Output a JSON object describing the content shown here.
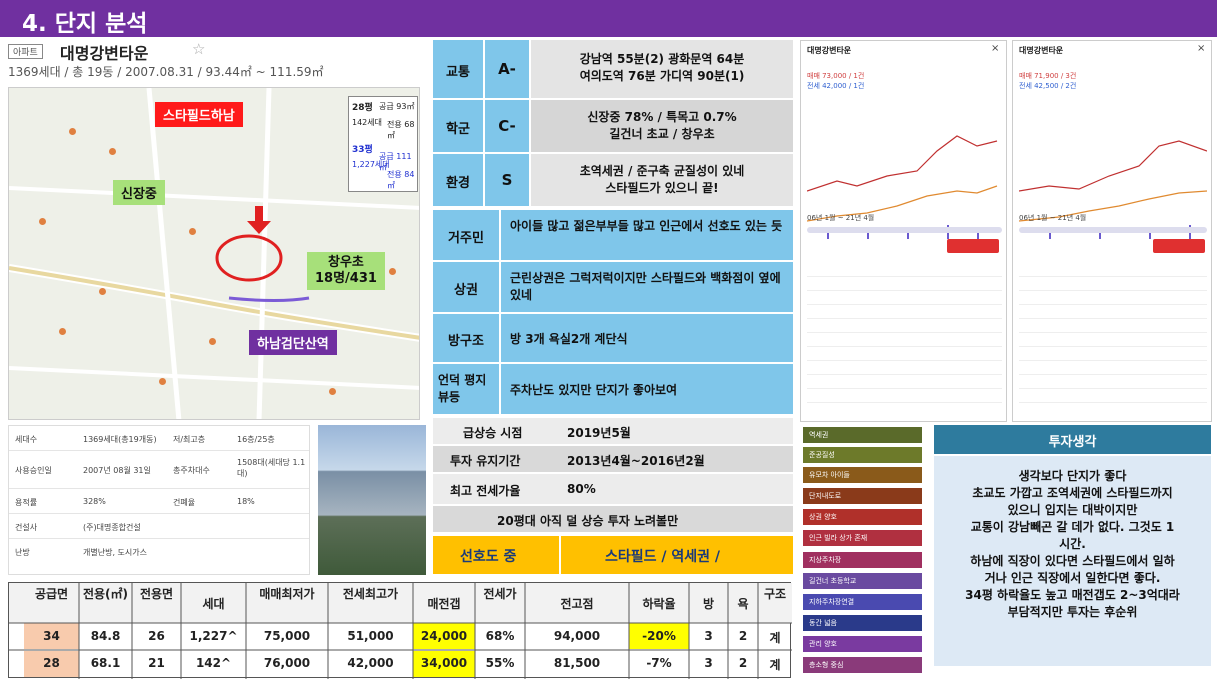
{
  "header": {
    "title": "4. 단지 분석"
  },
  "apt": {
    "tag": "아파트",
    "name": "대명강변타운",
    "star": "☆",
    "sub": "1369세대 / 총 19동 / 2007.08.31 / 93.44㎡ ~ 111.59㎡"
  },
  "map": {
    "labels": [
      "스타필드하남",
      "신장중",
      "창우초\n18명/431",
      "하남검단산역"
    ],
    "legend": [
      "28평",
      "공급 93㎡",
      "142세대",
      "전용 68㎡",
      "33평",
      "공급 111㎡",
      "1,227세대",
      "전용 84㎡"
    ]
  },
  "info": {
    "rows": [
      [
        "세대수",
        "1369세대(총19개동)",
        "저/최고층",
        "16층/25층"
      ],
      [
        "사용승인일",
        "2007년 08월 31일",
        "총주차대수",
        "1508대(세대당 1.1대)"
      ],
      [
        "용적률",
        "328%",
        "건폐율",
        "18%"
      ],
      [
        "건설사",
        "(주)대명종합건설",
        "",
        ""
      ],
      [
        "난방",
        "개별난방, 도시가스",
        "",
        ""
      ]
    ]
  },
  "grades": {
    "rows": [
      {
        "label": "교통",
        "grade": "A-",
        "desc": "강남역 55분(2) 광화문역 64분\n여의도역 76분 가디역 90분(1)"
      },
      {
        "label": "학군",
        "grade": "C-",
        "desc": "신장중 78% / 특목고 0.7%\n길건너 초교 / 창우초"
      },
      {
        "label": "환경",
        "grade": "S",
        "desc": "초역세권 / 준구축 균질성이 있네\n스타필드가 있으니 끝!"
      },
      {
        "label": "거주민",
        "grade": "",
        "desc": "아이들 많고 젊은부부들 많고 인근에서 선호도 있는 듯"
      },
      {
        "label": "상권",
        "grade": "",
        "desc": "근린상권은 그럭저럭이지만 스타필드와 백화점이 옆에 있네"
      },
      {
        "label": "방구조",
        "grade": "",
        "desc": "방 3개 욕실2개 계단식"
      },
      {
        "label": "언덕 평지 뷰등",
        "grade": "",
        "desc": "주차난도 있지만 단지가 좋아보여"
      }
    ]
  },
  "invest": {
    "rows": [
      [
        "급상승 시점",
        "2019년5월"
      ],
      [
        "투자 유지기간",
        "2013년4월~2016년2월"
      ],
      [
        "최고 전세가율",
        "80%"
      ]
    ],
    "note": "20평대 아직 덜 상승 투자 노려볼만",
    "pref_label": "선호도 중",
    "pref_value": "스타필드 / 역세권 /"
  },
  "bottom_table": {
    "headers": [
      "공급면",
      "전용(㎡)",
      "전용면",
      "세대",
      "매매최저가",
      "전세최고가",
      "매전갭",
      "전세가",
      "전고점",
      "하락율",
      "방",
      "욕",
      "구조"
    ],
    "rows": [
      [
        "34",
        "84.8",
        "26",
        "1,227^",
        "75,000",
        "51,000",
        "24,000",
        "68%",
        "94,000",
        "-20%",
        "3",
        "2",
        "계"
      ],
      [
        "28",
        "68.1",
        "21",
        "142^",
        "76,000",
        "42,000",
        "34,000",
        "55%",
        "81,500",
        "-7%",
        "3",
        "2",
        "계"
      ]
    ]
  },
  "charts": [
    {
      "title": "대명강변타운",
      "price1": "매매 73,000 / 1건",
      "price2": "전세 42,000 / 1건",
      "period": "06년 1월 ~ 21년 4월"
    },
    {
      "title": "대명강변타운",
      "price1": "매매 71,900 / 3건",
      "price2": "전세 42,500 / 2건",
      "period": "06년 1월 ~ 21년 4월"
    }
  ],
  "sidebar": {
    "items": [
      {
        "label": "역세권",
        "color": "#5a6a2a"
      },
      {
        "label": "준공질성",
        "color": "#6d7a2a"
      },
      {
        "label": "유모차 아이들",
        "color": "#8a5a1a"
      },
      {
        "label": "단지내도로",
        "color": "#8a3a1a"
      },
      {
        "label": "상권 양호",
        "color": "#b0302a"
      },
      {
        "label": "인근 빌라 상가 혼재",
        "color": "#b03040"
      },
      {
        "label": "지상주차장",
        "color": "#a03060"
      },
      {
        "label": "길건너 초등학교",
        "color": "#6a4aa0"
      },
      {
        "label": "지하주차장연결",
        "color": "#4a4ab0"
      },
      {
        "label": "동간 넓음",
        "color": "#2a3a8a"
      },
      {
        "label": "관리 양호",
        "color": "#7a3aa0"
      },
      {
        "label": "층소형 중심",
        "color": "#8a3a7a"
      }
    ]
  },
  "thoughts": {
    "title": "투자생각",
    "body": "생각보다 단지가 좋다\n초교도 가깝고 조역세권에 스타필드까지\n있으니 입지는 대박이지만\n교통이 강남빼곤 갈 데가 없다. 그것도 1\n시간.\n하남에 직장이 있다면 스타필드에서 일하\n거나 인근 직장에서 일한다면 좋다.\n34평 하락율도 높고 매전갭도 2~3억대라\n부담적지만 투자는 후순위"
  }
}
